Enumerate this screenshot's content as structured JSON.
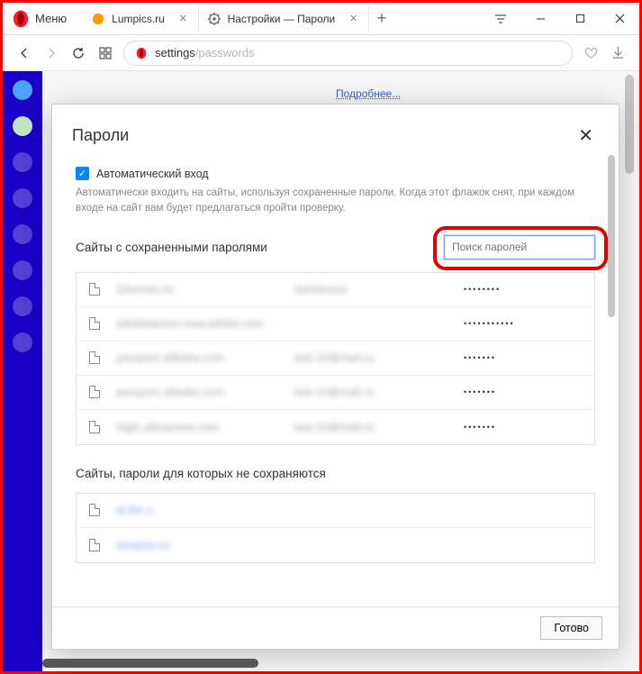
{
  "window": {
    "menu_label": "Меню",
    "tabs": [
      {
        "label": "Lumpics.ru",
        "favicon": "orange"
      },
      {
        "label": "Настройки — Пароли",
        "favicon": "gear"
      }
    ],
    "newtab_glyph": "+"
  },
  "addressbar": {
    "prefix": "settings",
    "path": "/passwords"
  },
  "backplane": {
    "details_link": "Подробнее..."
  },
  "modal": {
    "title": "Пароли",
    "close_glyph": "✕",
    "auto_login": {
      "checked": true,
      "label": "Автоматический вход",
      "description": "Автоматически входить на сайты, используя сохраненные пароли. Когда этот флажок снят, при каждом входе на сайт вам будет предлагаться пройти проверку."
    },
    "saved_section_title": "Сайты с сохраненными паролями",
    "search_placeholder": "Поиск паролей",
    "saved_rows": [
      {
        "site": "1themes.su",
        "user": "SanNoosa",
        "pass": "••••••••"
      },
      {
        "site": "adsdistancer-now.adobe.com",
        "user": "",
        "pass": "•••••••••••"
      },
      {
        "site": "passport.alibaba.com",
        "user": "last-10@mail.ru",
        "pass": "•••••••"
      },
      {
        "site": "passport.alibaba.com",
        "user": "last-10@mail.ru",
        "pass": "•••••••"
      },
      {
        "site": "login.aliexpress.com",
        "user": "last-10@mail.ru",
        "pass": "•••••••"
      }
    ],
    "never_section_title": "Сайты, пароли для которых не сохраняются",
    "never_rows": [
      {
        "site": "id.lite.1"
      },
      {
        "site": "amazon.ru"
      }
    ],
    "done_label": "Готово"
  }
}
